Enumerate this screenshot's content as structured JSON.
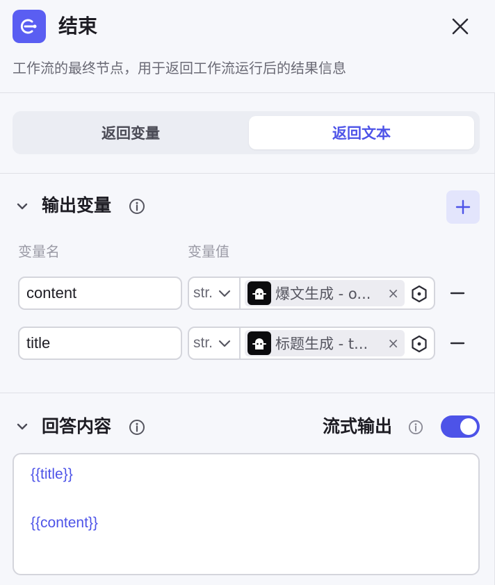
{
  "node": {
    "title": "结束",
    "description": "工作流的最终节点，用于返回工作流运行后的结果信息"
  },
  "tabs": [
    {
      "label": "返回变量",
      "active": false
    },
    {
      "label": "返回文本",
      "active": true
    }
  ],
  "output_vars": {
    "title": "输出变量",
    "col_name": "变量名",
    "col_value": "变量值",
    "rows": [
      {
        "name": "content",
        "type": "str.",
        "ref": "爆文生成 - o..."
      },
      {
        "name": "title",
        "type": "str.",
        "ref": "标题生成 - t..."
      }
    ]
  },
  "answer": {
    "title": "回答内容",
    "stream_label": "流式输出",
    "stream_enabled": true,
    "lines": [
      "{{title}}",
      "{{content}}"
    ]
  },
  "colors": {
    "accent": "#4d53e8",
    "node_icon_bg": "#5a5ef2",
    "add_button_bg": "#e3e5fc"
  },
  "icons": [
    "end-node-icon",
    "close-icon",
    "chevron-down-icon",
    "info-icon",
    "plus-icon",
    "caret-down-icon",
    "bot-avatar-icon",
    "remove-tag-icon",
    "variable-hex-icon",
    "minus-icon"
  ]
}
